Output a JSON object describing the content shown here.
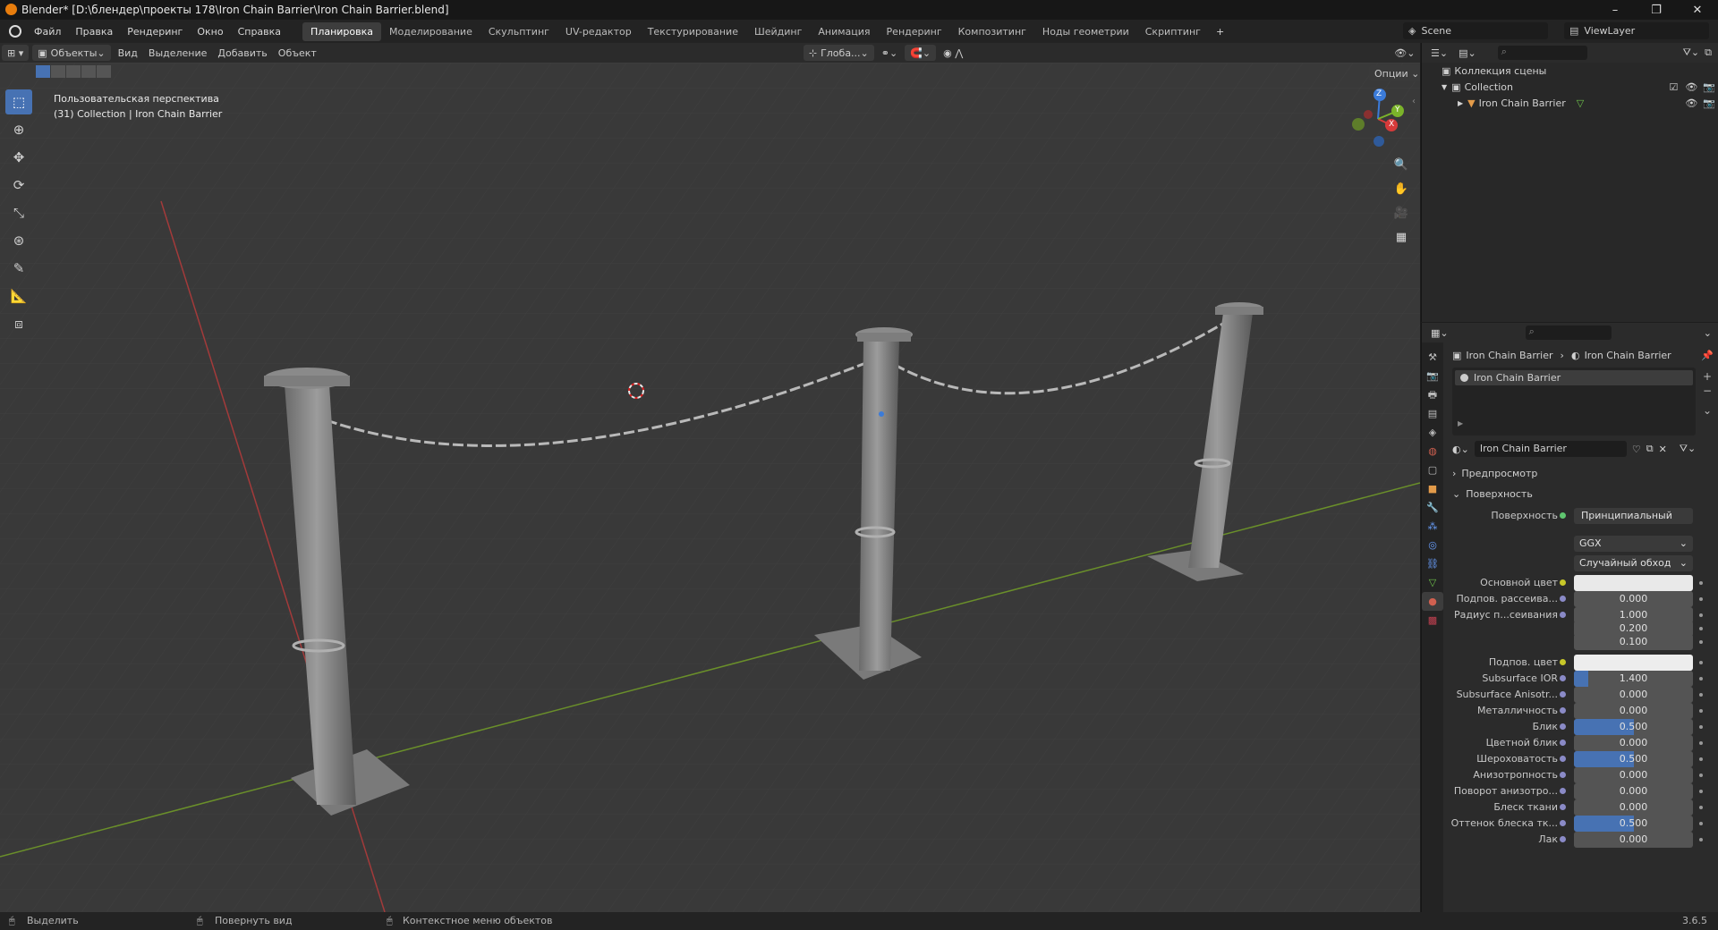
{
  "window": {
    "title": "Blender* [D:\\блендер\\проекты 178\\Iron Chain Barrier\\Iron Chain Barrier.blend]",
    "minimize": "–",
    "restore": "❐",
    "close": "✕"
  },
  "menu": {
    "items": [
      "Файл",
      "Правка",
      "Рендеринг",
      "Окно",
      "Справка"
    ],
    "workspaces": [
      "Планировка",
      "Моделирование",
      "Скульптинг",
      "UV-редактор",
      "Текстурирование",
      "Шейдинг",
      "Анимация",
      "Рендеринг",
      "Композитинг",
      "Ноды геометрии",
      "Скриптинг"
    ],
    "active_workspace": "Планировка",
    "add_tab": "+",
    "scene": "Scene",
    "view_layer": "ViewLayer"
  },
  "viewport_header": {
    "mode": "Объекты",
    "menus": [
      "Вид",
      "Выделение",
      "Добавить",
      "Объект"
    ],
    "orientation": "Глоба...",
    "options": "Опции"
  },
  "viewport": {
    "view_name": "Пользовательская перспектива",
    "collection_info": "(31) Collection | Iron Chain Barrier",
    "gizmo": {
      "z": "Z",
      "x": "X",
      "y": "Y"
    }
  },
  "outliner": {
    "scene_collection": "Коллекция сцены",
    "collection": "Collection",
    "object": "Iron Chain Barrier"
  },
  "properties": {
    "breadcrumb_object": "Iron Chain Barrier",
    "breadcrumb_material": "Iron Chain Barrier",
    "material_slot": "Iron Chain Barrier",
    "material_name": "Iron Chain Barrier",
    "sections": {
      "preview": "Предпросмотр",
      "surface": "Поверхность"
    },
    "surface_label": "Поверхность",
    "surface_value": "Принципиальный BSDF",
    "distribution": "GGX",
    "subsurface_method": "Случайный обход",
    "fields": [
      {
        "label": "Основной цвет",
        "type": "color",
        "value": "",
        "color": "#e9e9e9"
      },
      {
        "label": "Подпов. рассеива...",
        "type": "num",
        "value": "0.000",
        "fill": 0
      },
      {
        "label": "Радиус п...сеивания",
        "type": "num",
        "value": "1.000",
        "fill": 0
      },
      {
        "label": "",
        "type": "num",
        "value": "0.200",
        "fill": 0
      },
      {
        "label": "",
        "type": "num",
        "value": "0.100",
        "fill": 0
      },
      {
        "label": "Подпов. цвет",
        "type": "color",
        "value": "",
        "color": "#ededed"
      },
      {
        "label": "Subsurface IOR",
        "type": "num",
        "value": "1.400",
        "fill": 0.12
      },
      {
        "label": "Subsurface Anisotr...",
        "type": "num",
        "value": "0.000",
        "fill": 0
      },
      {
        "label": "Металличность",
        "type": "num",
        "value": "0.000",
        "fill": 0
      },
      {
        "label": "Блик",
        "type": "num",
        "value": "0.500",
        "fill": 0.5
      },
      {
        "label": "Цветной блик",
        "type": "num",
        "value": "0.000",
        "fill": 0
      },
      {
        "label": "Шероховатость",
        "type": "num",
        "value": "0.500",
        "fill": 0.5
      },
      {
        "label": "Анизотропность",
        "type": "num",
        "value": "0.000",
        "fill": 0
      },
      {
        "label": "Поворот анизотро...",
        "type": "num",
        "value": "0.000",
        "fill": 0
      },
      {
        "label": "Блеск ткани",
        "type": "num",
        "value": "0.000",
        "fill": 0
      },
      {
        "label": "Оттенок блеска тк...",
        "type": "num",
        "value": "0.500",
        "fill": 0.5
      },
      {
        "label": "Лак",
        "type": "num",
        "value": "0.000",
        "fill": 0
      }
    ]
  },
  "status": {
    "select": "Выделить",
    "rotate": "Повернуть вид",
    "context": "Контекстное меню объектов",
    "version": "3.6.5"
  },
  "colors": {
    "accent": "#4772b3",
    "x_axis": "#a33a3a",
    "y_axis": "#6a8f2a"
  }
}
